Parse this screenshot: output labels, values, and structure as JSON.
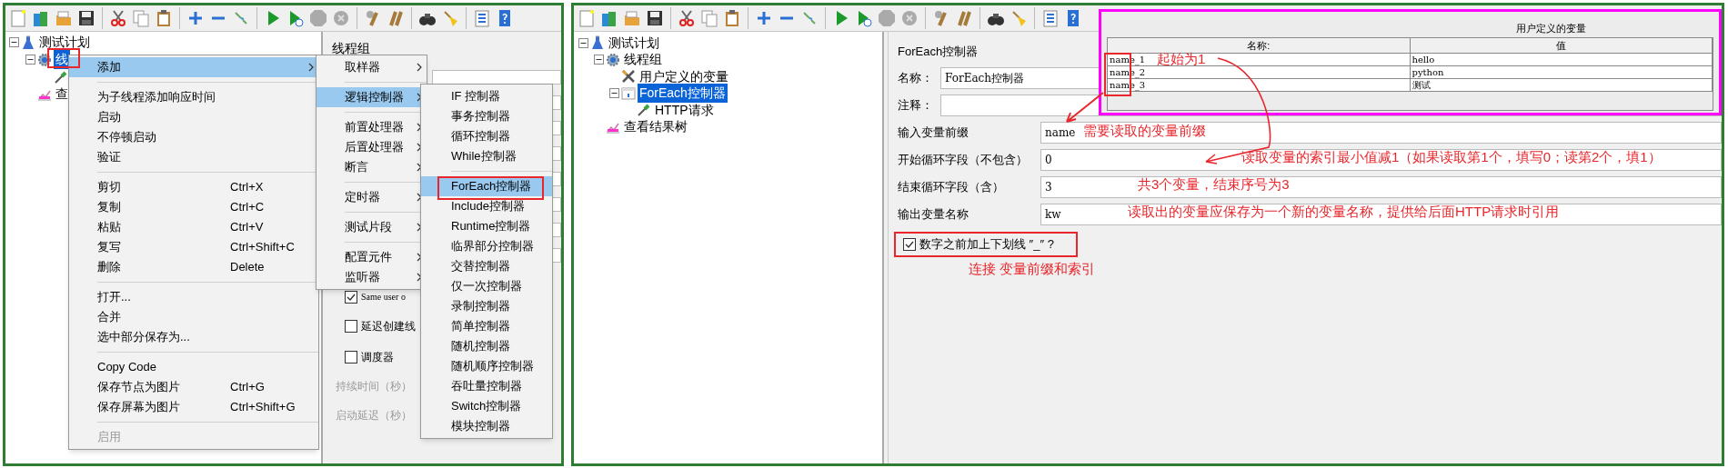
{
  "left_screenshot": {
    "tree": [
      {
        "label": "测试计划",
        "kind": "plan",
        "selected": false,
        "expanded": true,
        "children": [
          {
            "label": "线",
            "kind": "thread_group",
            "selected": true,
            "expanded": true,
            "children": [
              {
                "kind": "sampler"
              }
            ]
          },
          {
            "label": "查",
            "kind": "listener",
            "selected": false
          }
        ]
      }
    ],
    "detail": {
      "title": "线程组",
      "checkboxes": [
        {
          "label": "Same user o",
          "checked": true
        },
        {
          "label": "延迟创建线",
          "checked": false
        },
        {
          "label": "调度器",
          "checked": false
        }
      ],
      "disabled_labels": [
        "持续时间（秒）",
        "启动延迟（秒）"
      ]
    },
    "context_menu": {
      "items": [
        {
          "kind": "item",
          "label": "添加",
          "submenu": true,
          "selected": true,
          "disabled": false
        },
        {
          "kind": "separator"
        },
        {
          "kind": "item",
          "label": "为子线程添加响应时间",
          "submenu": false,
          "selected": false,
          "disabled": false
        },
        {
          "kind": "item",
          "label": "启动",
          "submenu": false,
          "selected": false,
          "disabled": false
        },
        {
          "kind": "item",
          "label": "不停顿启动",
          "submenu": false,
          "selected": false,
          "disabled": false
        },
        {
          "kind": "item",
          "label": "验证",
          "submenu": false,
          "selected": false,
          "disabled": false
        },
        {
          "kind": "separator"
        },
        {
          "kind": "item",
          "label": "剪切",
          "shortcut": "Ctrl+X",
          "submenu": false,
          "selected": false,
          "disabled": false
        },
        {
          "kind": "item",
          "label": "复制",
          "shortcut": "Ctrl+C",
          "submenu": false,
          "selected": false,
          "disabled": false
        },
        {
          "kind": "item",
          "label": "粘贴",
          "shortcut": "Ctrl+V",
          "submenu": false,
          "selected": false,
          "disabled": false
        },
        {
          "kind": "item",
          "label": "复写",
          "shortcut": "Ctrl+Shift+C",
          "submenu": false,
          "selected": false,
          "disabled": false
        },
        {
          "kind": "item",
          "label": "删除",
          "shortcut": "Delete",
          "submenu": false,
          "selected": false,
          "disabled": false
        },
        {
          "kind": "separator"
        },
        {
          "kind": "item",
          "label": "打开...",
          "submenu": false,
          "selected": false,
          "disabled": false
        },
        {
          "kind": "item",
          "label": "合并",
          "submenu": false,
          "selected": false,
          "disabled": false
        },
        {
          "kind": "item",
          "label": "选中部分保存为...",
          "submenu": false,
          "selected": false,
          "disabled": false
        },
        {
          "kind": "separator"
        },
        {
          "kind": "item",
          "label": "Copy Code",
          "submenu": false,
          "selected": false,
          "disabled": false
        },
        {
          "kind": "item",
          "label": "保存节点为图片",
          "shortcut": "Ctrl+G",
          "submenu": false,
          "selected": false,
          "disabled": false
        },
        {
          "kind": "item",
          "label": "保存屏幕为图片",
          "shortcut": "Ctrl+Shift+G",
          "submenu": false,
          "selected": false,
          "disabled": false
        },
        {
          "kind": "separator"
        },
        {
          "kind": "item",
          "label": "启用",
          "submenu": false,
          "selected": false,
          "disabled": true
        }
      ]
    },
    "add_submenu": {
      "items": [
        {
          "kind": "item",
          "label": "取样器",
          "selected": false
        },
        {
          "kind": "separator"
        },
        {
          "kind": "item",
          "label": "逻辑控制器",
          "selected": true
        },
        {
          "kind": "separator"
        },
        {
          "kind": "item",
          "label": "前置处理器",
          "selected": false
        },
        {
          "kind": "item",
          "label": "后置处理器",
          "selected": false
        },
        {
          "kind": "item",
          "label": "断言",
          "selected": false
        },
        {
          "kind": "separator"
        },
        {
          "kind": "item",
          "label": "定时器",
          "selected": false
        },
        {
          "kind": "separator"
        },
        {
          "kind": "item",
          "label": "测试片段",
          "selected": false
        },
        {
          "kind": "separator"
        },
        {
          "kind": "item",
          "label": "配置元件",
          "selected": false
        },
        {
          "kind": "item",
          "label": "监听器",
          "selected": false
        }
      ]
    },
    "logic_controller_submenu": {
      "items": [
        {
          "kind": "item",
          "label": "IF 控制器",
          "selected": false
        },
        {
          "kind": "item",
          "label": "事务控制器",
          "selected": false
        },
        {
          "kind": "item",
          "label": "循环控制器",
          "selected": false
        },
        {
          "kind": "item",
          "label": "While控制器",
          "selected": false
        },
        {
          "kind": "separator"
        },
        {
          "kind": "item",
          "label": "ForEach控制器",
          "selected": true
        },
        {
          "kind": "item",
          "label": "Include控制器",
          "selected": false
        },
        {
          "kind": "item",
          "label": "Runtime控制器",
          "selected": false
        },
        {
          "kind": "item",
          "label": "临界部分控制器",
          "selected": false
        },
        {
          "kind": "item",
          "label": "交替控制器",
          "selected": false
        },
        {
          "kind": "item",
          "label": "仅一次控制器",
          "selected": false
        },
        {
          "kind": "item",
          "label": "录制控制器",
          "selected": false
        },
        {
          "kind": "item",
          "label": "简单控制器",
          "selected": false
        },
        {
          "kind": "item",
          "label": "随机控制器",
          "selected": false
        },
        {
          "kind": "item",
          "label": "随机顺序控制器",
          "selected": false
        },
        {
          "kind": "item",
          "label": "吞吐量控制器",
          "selected": false
        },
        {
          "kind": "item",
          "label": "Switch控制器",
          "selected": false
        },
        {
          "kind": "item",
          "label": "模块控制器",
          "selected": false
        }
      ]
    }
  },
  "right_screenshot": {
    "tree": [
      {
        "label": "测试计划",
        "kind": "plan",
        "selected": false,
        "expanded": true,
        "children": [
          {
            "label": "线程组",
            "kind": "thread_group",
            "selected": false,
            "expanded": true,
            "children": [
              {
                "label": "用户定义的变量",
                "kind": "config",
                "selected": false
              },
              {
                "label": "ForEach控制器",
                "kind": "controller",
                "selected": true,
                "expanded": true,
                "children": [
                  {
                    "label": "HTTP请求",
                    "kind": "sampler",
                    "selected": false
                  }
                ]
              }
            ]
          },
          {
            "label": "查看结果树",
            "kind": "listener",
            "selected": false
          }
        ]
      }
    ],
    "editor": {
      "title": "ForEach控制器",
      "name_label": "名称：",
      "name_value": "ForEach控制器",
      "comment_label": "注释：",
      "fields": [
        {
          "label": "输入变量前缀",
          "value": "name"
        },
        {
          "label": "开始循环字段（不包含）",
          "value": "0"
        },
        {
          "label": "结束循环字段（含）",
          "value": "3"
        },
        {
          "label": "输出变量名称",
          "value": "kw"
        }
      ],
      "checkbox": {
        "label": "数字之前加上下划线 ″_″ ?",
        "checked": true
      }
    },
    "variables_inset": {
      "title": "用户定义的变量",
      "columns": [
        "名称:",
        "值"
      ],
      "rows": [
        [
          "name_1",
          "hello"
        ],
        [
          "name_2",
          "python"
        ],
        [
          "name_3",
          "测试"
        ]
      ]
    },
    "annotations": [
      {
        "text": "起始为1"
      },
      {
        "text": "需要读取的变量前缀"
      },
      {
        "text": "读取变量的索引最小值减1（如果读取第1个，填写0；读第2个，填1）"
      },
      {
        "text": "共3个变量，结束序号为3"
      },
      {
        "text": "读取出的变量应保存为一个新的变量名称，提供给后面HTTP请求时引用"
      },
      {
        "text": "连接 变量前缀和索引"
      }
    ]
  }
}
